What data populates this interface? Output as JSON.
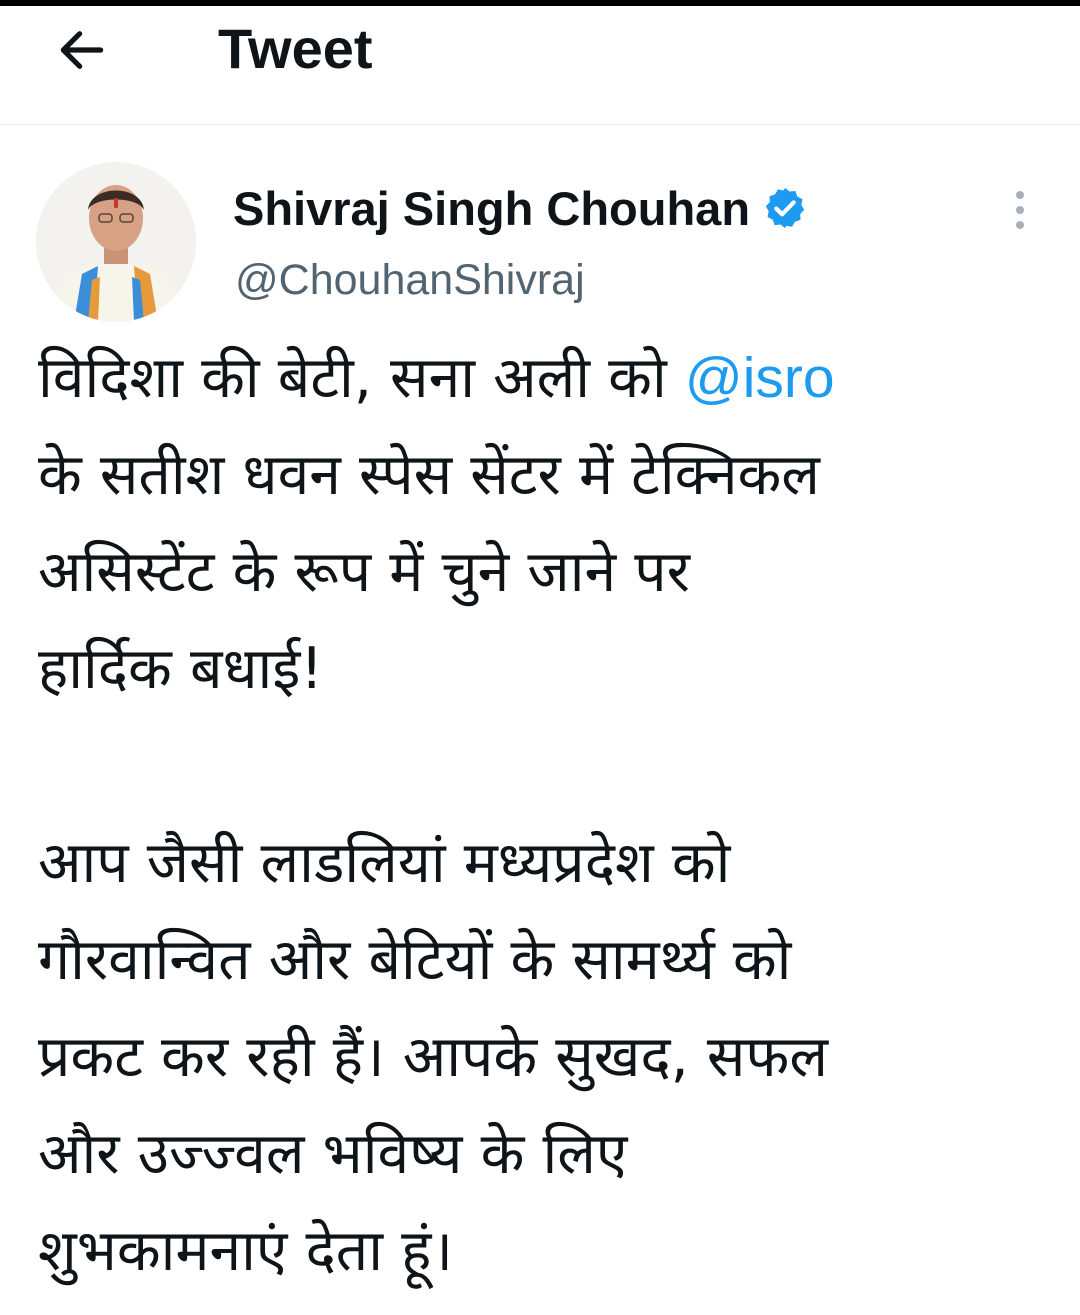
{
  "header": {
    "title": "Tweet",
    "back_icon": "arrow-left-icon"
  },
  "author": {
    "display_name": "Shivraj Singh Chouhan",
    "handle": "@ChouhanShivraj",
    "verified": true,
    "verified_icon": "verified-badge-icon",
    "avatar_icon": "profile-photo"
  },
  "more_icon": "more-vertical-icon",
  "tweet": {
    "para1_line1_before": "विदिशा की बेटी, सना अली को",
    "para1_mention": "@isro",
    "para1_line2": "के सतीश धवन स्पेस सेंटर में टेक्निकल",
    "para1_line3": "असिस्टेंट के रूप में चुने जाने पर",
    "para1_line4": "हार्दिक बधाई!",
    "para2_line1": "आप जैसी लाडलियां मध्यप्रदेश को",
    "para2_line2": "गौरवान्वित और बेटियों के सामर्थ्य को",
    "para2_line3": "प्रकट कर रही हैं। आपके सुखद, सफल",
    "para2_line4": "और उज्ज्वल भविष्य के लिए",
    "para2_line5": "शुभकामनाएं देता हूं।"
  },
  "colors": {
    "text": "#0f1419",
    "secondary": "#536471",
    "link": "#1d9bf0",
    "divider": "#e6e9ec"
  }
}
